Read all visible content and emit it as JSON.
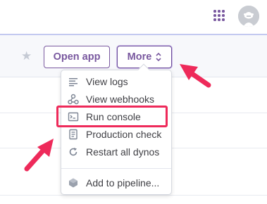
{
  "header": {
    "apps_icon": "apps-grid-icon",
    "avatar_icon": "user-avatar-icon"
  },
  "app_bar": {
    "favorite_icon": "star-icon",
    "open_app_label": "Open app",
    "more_label": "More",
    "more_icon": "updown-chevron-icon"
  },
  "more_menu": {
    "items": [
      {
        "label": "View logs",
        "icon": "logs-icon"
      },
      {
        "label": "View webhooks",
        "icon": "webhooks-icon"
      },
      {
        "label": "Run console",
        "icon": "console-icon",
        "highlighted": true
      },
      {
        "label": "Production check",
        "icon": "checklist-icon"
      },
      {
        "label": "Restart all dynos",
        "icon": "restart-icon"
      },
      {
        "label": "Add to pipeline...",
        "icon": "pipeline-icon"
      }
    ]
  },
  "annotations": {
    "highlight_color": "#ee2a5a",
    "arrow_color": "#ee2a5a"
  },
  "colors": {
    "accent": "#79589f",
    "divider": "#c3c9f0"
  }
}
